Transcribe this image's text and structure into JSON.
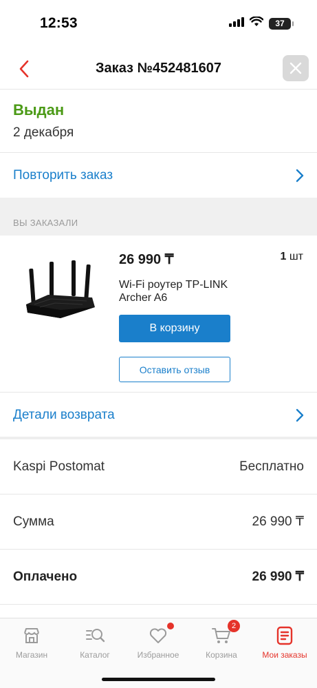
{
  "status_bar": {
    "time": "12:53",
    "battery": "37"
  },
  "nav": {
    "title": "Заказ №452481607"
  },
  "order": {
    "status": "Выдан",
    "date": "2 декабря"
  },
  "actions": {
    "repeat_order": "Повторить заказ",
    "return_details": "Детали возврата"
  },
  "section": {
    "ordered_header": "ВЫ ЗАКАЗАЛИ"
  },
  "product": {
    "price": "26 990 ₸",
    "qty_number": "1",
    "qty_unit": "шт",
    "name": "Wi-Fi роутер TP-LINK Archer A6",
    "cart_button": "В корзину",
    "review_button": "Оставить отзыв"
  },
  "summary": {
    "delivery_label": "Kaspi Postomat",
    "delivery_value": "Бесплатно",
    "sum_label": "Сумма",
    "sum_value": "26 990 ₸",
    "paid_label": "Оплачено",
    "paid_value": "26 990 ₸"
  },
  "tabs": [
    {
      "label": "Магазин",
      "icon": "shop-icon"
    },
    {
      "label": "Каталог",
      "icon": "catalog-icon"
    },
    {
      "label": "Избранное",
      "icon": "heart-icon"
    },
    {
      "label": "Корзина",
      "icon": "cart-icon",
      "badge": "2"
    },
    {
      "label": "Мои заказы",
      "icon": "orders-icon"
    }
  ],
  "colors": {
    "accent_blue": "#1a7fcb",
    "status_green": "#4b9a16",
    "brand_red": "#e5332a"
  }
}
